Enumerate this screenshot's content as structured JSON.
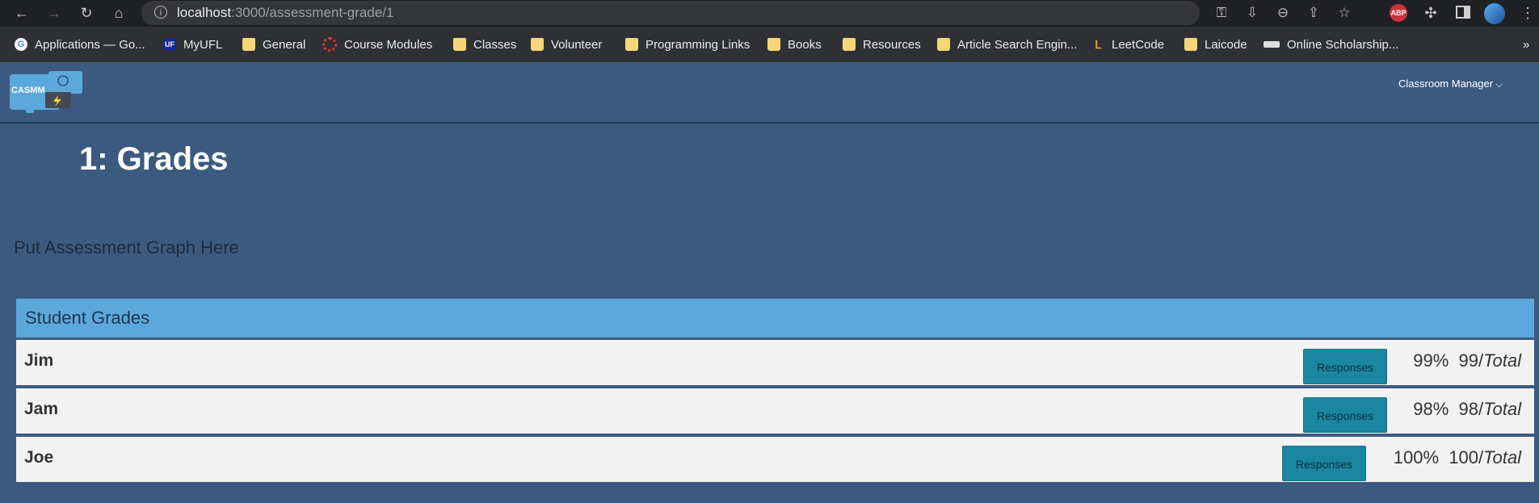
{
  "browser": {
    "url_host": "localhost",
    "url_path": ":3000/assessment-grade/1"
  },
  "bookmarks": [
    {
      "label": "Applications — Go...",
      "icon": "google-icon"
    },
    {
      "label": "MyUFL",
      "icon": "uf-icon",
      "icon_text": "UF"
    },
    {
      "label": "General",
      "icon": "folder-icon"
    },
    {
      "label": "Course Modules",
      "icon": "canvas-icon"
    },
    {
      "label": "Classes",
      "icon": "folder-icon"
    },
    {
      "label": "Volunteer",
      "icon": "folder-icon"
    },
    {
      "label": "Programming Links",
      "icon": "folder-icon"
    },
    {
      "label": "Books",
      "icon": "folder-icon"
    },
    {
      "label": "Resources",
      "icon": "folder-icon"
    },
    {
      "label": "Article Search Engin...",
      "icon": "folder-icon"
    },
    {
      "label": "LeetCode",
      "icon": "leetcode-icon"
    },
    {
      "label": "Laicode",
      "icon": "folder-icon"
    },
    {
      "label": "Online Scholarship...",
      "icon": "scholarship-icon"
    }
  ],
  "extensions": {
    "adblock_text": "ABP"
  },
  "more_bookmarks": "»",
  "app": {
    "logo_text": "CASMM",
    "manager_menu": "Classroom Manager",
    "manager_chevron": "⌵"
  },
  "page": {
    "title": "1: Grades",
    "graph_placeholder": "Put Assessment Graph Here"
  },
  "grades": {
    "header": "Student Grades",
    "responses_label": "Responses",
    "total_label": "Total",
    "rows": [
      {
        "name": "Jim",
        "percent": "99%",
        "score": "99/"
      },
      {
        "name": "Jam",
        "percent": "98%",
        "score": "98/"
      },
      {
        "name": "Joe",
        "percent": "100%",
        "score": "100/"
      }
    ]
  },
  "colors": {
    "page_bg": "#3c5a80",
    "card_header": "#5ca8dc",
    "row_bg": "#f2f2f2",
    "button": "#1a86a0"
  }
}
